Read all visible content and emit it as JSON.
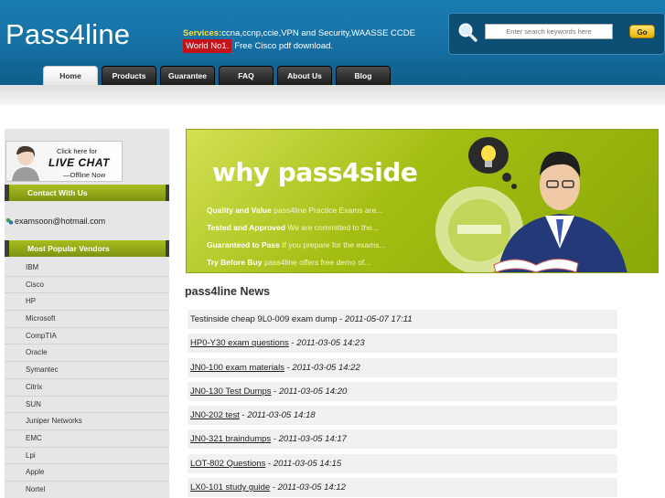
{
  "header": {
    "logo": "Pass4line",
    "services_label": "Services:",
    "services_text": "ccna,ccnp,ccie,VPN and Security,WAASSE CCDE",
    "badge": "World No1.",
    "tagline": "Free Cisco pdf download.",
    "search": {
      "placeholder": "Enter search keywords here",
      "button": "Go"
    },
    "colors": {
      "header": "#1670a3",
      "accent": "#a3bd12",
      "badge": "#c4121b"
    }
  },
  "nav": {
    "tabs": [
      {
        "label": "Home",
        "active": true
      },
      {
        "label": "Products"
      },
      {
        "label": "Guarantee"
      },
      {
        "label": "FAQ"
      },
      {
        "label": "About Us"
      },
      {
        "label": "Blog"
      }
    ]
  },
  "sidebar": {
    "live_chat": {
      "line1": "Click here for",
      "line2": "LIVE CHAT",
      "line3": "—Offline Now"
    },
    "contact_head": "Contact With Us",
    "email": "examsoon@hotmail.com",
    "vendors_head": "Most Popular Vendors",
    "vendors": [
      "IBM",
      "Cisco",
      "HP",
      "Microsoft",
      "CompTIA",
      "Oracle",
      "Symantec",
      "Citrix",
      "SUN",
      "Juniper Networks",
      "EMC",
      "Lpi",
      "Apple",
      "Nortel"
    ]
  },
  "banner": {
    "title": "why pass4side",
    "lines": [
      {
        "bold": "Quality and Value",
        "text": " pass4line Practice Exams are..."
      },
      {
        "bold": "Tested and Approved",
        "text": " We are committed to the..."
      },
      {
        "bold": "Guaranteed to Pass",
        "text": " If you prepare for the exams..."
      },
      {
        "bold": "Try Before Buy",
        "text": " pass4line offers free demo of..."
      }
    ]
  },
  "news": {
    "title": "pass4line News",
    "items": [
      {
        "title": "Testinside cheap 9L0-009 exam dump",
        "date": "2011-05-07 17:11",
        "linked": false
      },
      {
        "title": "HP0-Y30 exam questions",
        "date": "2011-03-05 14:23",
        "linked": true
      },
      {
        "title": "JN0-100 exam materials",
        "date": "2011-03-05 14:22",
        "linked": true
      },
      {
        "title": "JN0-130 Test Dumps",
        "date": "2011-03-05 14:20",
        "linked": true
      },
      {
        "title": "JN0-202 test",
        "date": "2011-03-05 14:18",
        "linked": true
      },
      {
        "title": "JN0-321 braindumps",
        "date": "2011-03-05 14:17",
        "linked": true
      },
      {
        "title": "LOT-802 Questions",
        "date": "2011-03-05 14:15",
        "linked": true
      },
      {
        "title": "LX0-101 study guide",
        "date": "2011-03-05 14:12",
        "linked": true
      }
    ]
  }
}
